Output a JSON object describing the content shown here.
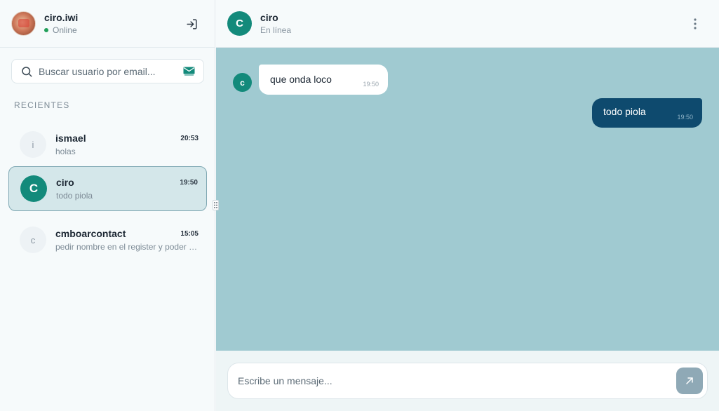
{
  "sidebar": {
    "user": {
      "name": "ciro.iwi",
      "status": "Online"
    },
    "search": {
      "placeholder": "Buscar usuario por email..."
    },
    "section_label": "RECIENTES",
    "conversations": [
      {
        "initial": "i",
        "name": "ismael",
        "time": "20:53",
        "last": "holas",
        "active": false
      },
      {
        "initial": "C",
        "name": "ciro",
        "time": "19:50",
        "last": "todo piola",
        "active": true
      },
      {
        "initial": "c",
        "name": "cmboarcontact",
        "time": "15:05",
        "last": "pedir nombre en el register y poder …",
        "active": false
      }
    ]
  },
  "chat": {
    "peer": {
      "initial": "C",
      "name": "ciro",
      "status": "En línea"
    },
    "messages": [
      {
        "direction": "in",
        "avatar": "c",
        "text": "que onda loco",
        "time": "19:50"
      },
      {
        "direction": "out",
        "text": "todo piola",
        "time": "19:50"
      }
    ],
    "composer": {
      "placeholder": "Escribe un mensaje..."
    }
  },
  "colors": {
    "accent": "#138a7b",
    "outgoing_bubble": "#0e4a6e",
    "chat_bg": "#a0cad1",
    "online": "#22a05a"
  },
  "icons": [
    "logout-icon",
    "search-icon",
    "mail-icon",
    "grip-icon",
    "more-vertical-icon",
    "send-icon"
  ]
}
